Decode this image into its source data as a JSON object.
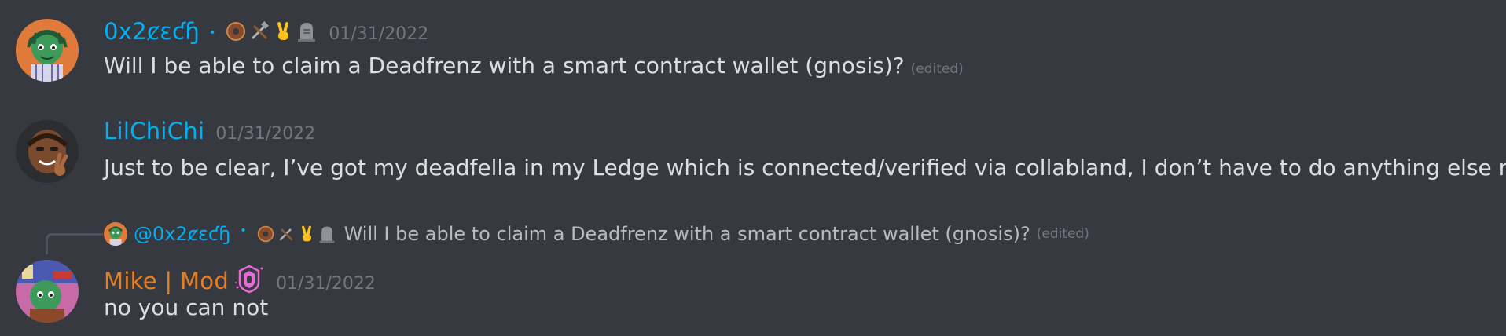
{
  "messages": [
    {
      "username": "0x2ȼɛƈɧ",
      "user_color": "#00b0f4",
      "separator": "•",
      "badges": [
        "donut-emoji",
        "tools-emoji",
        "victory-hand-emoji",
        "headstone-emoji"
      ],
      "timestamp": "01/31/2022",
      "text": "Will I be able to claim a Deadfrenz with a smart contract wallet (gnosis)?",
      "edited": "(edited)"
    },
    {
      "username": "LilChiChi",
      "user_color": "#00b0f4",
      "timestamp": "01/31/2022",
      "text": "Just to be clear, I’ve got my deadfella in my Ledge which is connected/verified via collabland, I don’t have to do anything else right?"
    },
    {
      "reply": {
        "mention": "@0x2ȼɛƈɧ",
        "separator": "•",
        "text": "Will I be able to claim a Deadfrenz with a smart contract wallet (gnosis)?",
        "edited": "(edited)"
      },
      "username": "Mike | Mod",
      "user_color": "#e67e22",
      "badge": "mod-shield-icon",
      "timestamp": "01/31/2022",
      "text": "no you can not"
    }
  ]
}
